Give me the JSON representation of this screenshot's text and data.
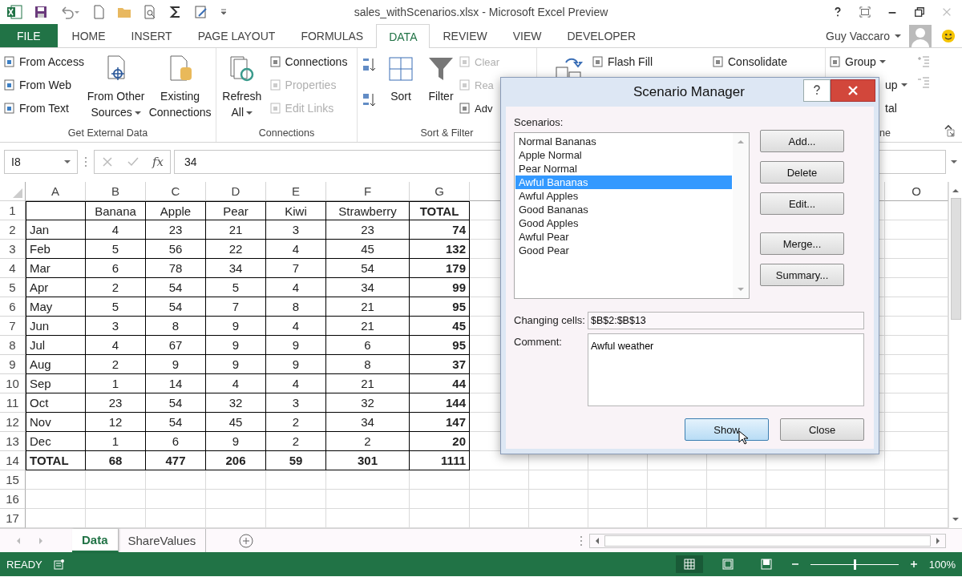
{
  "window": {
    "title": "sales_withScenarios.xlsx - Microsoft Excel Preview"
  },
  "ribbon_tabs": [
    {
      "label": "FILE",
      "kind": "file",
      "selected": false
    },
    {
      "label": "HOME",
      "kind": "tab",
      "selected": false
    },
    {
      "label": "INSERT",
      "kind": "tab",
      "selected": false
    },
    {
      "label": "PAGE LAYOUT",
      "kind": "tab",
      "selected": false
    },
    {
      "label": "FORMULAS",
      "kind": "tab",
      "selected": false
    },
    {
      "label": "DATA",
      "kind": "tab",
      "selected": true
    },
    {
      "label": "REVIEW",
      "kind": "tab",
      "selected": false
    },
    {
      "label": "VIEW",
      "kind": "tab",
      "selected": false
    },
    {
      "label": "DEVELOPER",
      "kind": "tab",
      "selected": false
    }
  ],
  "user": {
    "name": "Guy Vaccaro"
  },
  "ribbon_groups": [
    {
      "kind": "normal",
      "label": "Get External Data",
      "columns": [
        {
          "kind": "stack",
          "items": [
            {
              "label": "From Access",
              "disabled": false
            },
            {
              "label": "From Web",
              "disabled": false
            },
            {
              "label": "From Text",
              "disabled": false
            }
          ]
        },
        {
          "kind": "large",
          "label": "From Other Sources",
          "dropdown": true
        },
        {
          "kind": "large",
          "label": "Existing Connections",
          "dropdown": false
        }
      ]
    },
    {
      "kind": "normal",
      "label": "Connections",
      "columns": [
        {
          "kind": "large",
          "label": "Refresh All",
          "dropdown": true
        },
        {
          "kind": "stack",
          "items": [
            {
              "label": "Connections",
              "disabled": false
            },
            {
              "label": "Properties",
              "disabled": true
            },
            {
              "label": "Edit Links",
              "disabled": true
            }
          ]
        }
      ]
    },
    {
      "kind": "normal",
      "label": "Sort & Filter",
      "columns": [
        {
          "kind": "sort_pair"
        },
        {
          "kind": "large",
          "label": "Sort",
          "dropdown": false
        },
        {
          "kind": "large",
          "label": "Filter",
          "dropdown": false
        },
        {
          "kind": "stack",
          "items": [
            {
              "label": "Clear",
              "disabled": true
            },
            {
              "label": "Rea",
              "disabled": true
            },
            {
              "label": "Adv",
              "disabled": false
            }
          ]
        }
      ]
    },
    {
      "kind": "covered",
      "columns": [
        {
          "kind": "partial_icon"
        },
        {
          "kind": "stack",
          "items": [
            {
              "label": "Flash Fill",
              "disabled": false
            }
          ]
        },
        {
          "kind": "stack",
          "items": [
            {
              "label": "Consolidate",
              "disabled": false
            }
          ]
        }
      ]
    },
    {
      "kind": "clipped",
      "label": "ne",
      "columns": [
        {
          "kind": "stack",
          "items": [
            {
              "label": "Group",
              "disabled": false,
              "dropdown": true
            },
            {
              "label": "up",
              "disabled": false,
              "dropdown": true,
              "cut": true
            },
            {
              "label": "tal",
              "disabled": false,
              "cut": true
            }
          ]
        }
      ]
    }
  ],
  "formula_bar": {
    "name_box": "I8",
    "fx": "fx",
    "value": "34"
  },
  "sheet": {
    "columns": [
      "A",
      "B",
      "C",
      "D",
      "E",
      "F",
      "G",
      "O"
    ],
    "rows": [
      {
        "number": "1",
        "kind": "header",
        "values": [
          "Banana",
          "Apple",
          "Pear",
          "Kiwi",
          "Strawberry"
        ],
        "total": "TOTAL"
      },
      {
        "number": "2",
        "kind": "data",
        "label": "Jan",
        "values": [
          "4",
          "23",
          "21",
          "3",
          "23"
        ],
        "total": "74"
      },
      {
        "number": "3",
        "kind": "data",
        "label": "Feb",
        "values": [
          "5",
          "56",
          "22",
          "4",
          "45"
        ],
        "total": "132"
      },
      {
        "number": "4",
        "kind": "data",
        "label": "Mar",
        "values": [
          "6",
          "78",
          "34",
          "7",
          "54"
        ],
        "total": "179"
      },
      {
        "number": "5",
        "kind": "data",
        "label": "Apr",
        "values": [
          "2",
          "54",
          "5",
          "4",
          "34"
        ],
        "total": "99"
      },
      {
        "number": "6",
        "kind": "data",
        "label": "May",
        "values": [
          "5",
          "54",
          "7",
          "8",
          "21"
        ],
        "total": "95"
      },
      {
        "number": "7",
        "kind": "data",
        "label": "Jun",
        "values": [
          "3",
          "8",
          "9",
          "4",
          "21"
        ],
        "total": "45"
      },
      {
        "number": "8",
        "kind": "data",
        "label": "Jul",
        "values": [
          "4",
          "67",
          "9",
          "9",
          "6"
        ],
        "total": "95"
      },
      {
        "number": "9",
        "kind": "data",
        "label": "Aug",
        "values": [
          "2",
          "9",
          "9",
          "9",
          "8"
        ],
        "total": "37"
      },
      {
        "number": "10",
        "kind": "data",
        "label": "Sep",
        "values": [
          "1",
          "14",
          "4",
          "4",
          "21"
        ],
        "total": "44"
      },
      {
        "number": "11",
        "kind": "data",
        "label": "Oct",
        "values": [
          "23",
          "54",
          "32",
          "3",
          "32"
        ],
        "total": "144"
      },
      {
        "number": "12",
        "kind": "data",
        "label": "Nov",
        "values": [
          "12",
          "54",
          "45",
          "2",
          "34"
        ],
        "total": "147"
      },
      {
        "number": "13",
        "kind": "data",
        "label": "Dec",
        "values": [
          "1",
          "6",
          "9",
          "2",
          "2"
        ],
        "total": "20"
      },
      {
        "number": "14",
        "kind": "total",
        "label": "TOTAL",
        "values": [
          "68",
          "477",
          "206",
          "59",
          "301"
        ],
        "total": "1111"
      },
      {
        "number": "15",
        "kind": "empty"
      },
      {
        "number": "16",
        "kind": "empty"
      },
      {
        "number": "17",
        "kind": "empty"
      }
    ]
  },
  "sheet_tabs": [
    {
      "label": "Data",
      "selected": true
    },
    {
      "label": "ShareValues",
      "selected": false
    }
  ],
  "status_bar": {
    "mode": "READY",
    "views": [
      {
        "selected": true
      },
      {
        "selected": false
      },
      {
        "selected": false
      }
    ],
    "zoom": {
      "level": 0.5,
      "reading": "100%"
    }
  },
  "dialog": {
    "title": "Scenario Manager",
    "scenarios_label": "Scenarios:",
    "scenarios": [
      {
        "label": "Normal Bananas",
        "selected": false
      },
      {
        "label": "Apple Normal",
        "selected": false
      },
      {
        "label": "Pear Normal",
        "selected": false
      },
      {
        "label": "Awful Bananas",
        "selected": true
      },
      {
        "label": "Awful Apples",
        "selected": false
      },
      {
        "label": "Good Bananas",
        "selected": false
      },
      {
        "label": "Good Apples",
        "selected": false
      },
      {
        "label": "Awful Pear",
        "selected": false
      },
      {
        "label": "Good Pear",
        "selected": false
      }
    ],
    "button_groups": [
      [
        "Add...",
        "Delete",
        "Edit..."
      ],
      [
        "Merge...",
        "Summary..."
      ]
    ],
    "changing_cells": {
      "label": "Changing cells:",
      "value": "$B$2:$B$13"
    },
    "comment": {
      "label": "Comment:",
      "value": "Awful weather"
    },
    "footer_buttons": [
      {
        "label": "Show",
        "focused": true
      },
      {
        "label": "Close",
        "focused": false
      }
    ]
  }
}
